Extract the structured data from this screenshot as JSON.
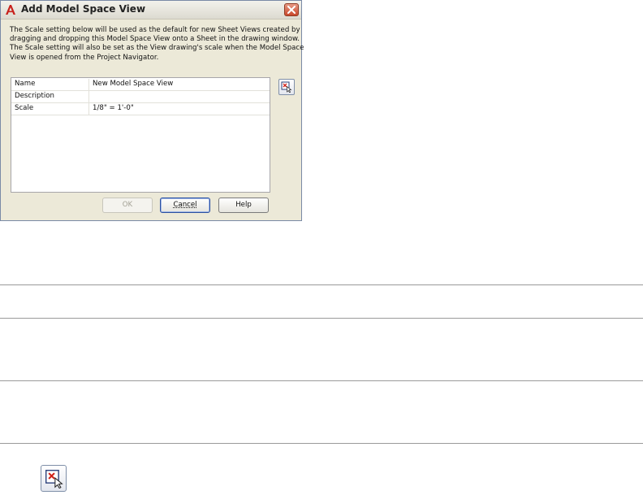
{
  "dialog": {
    "title": "Add Model Space View",
    "title_icon": "autocad-a-icon",
    "close_icon": "close-icon",
    "description_lines": [
      "The Scale setting below will be used as the default for new Sheet Views created by",
      "dragging and dropping this Model Space View onto a Sheet in the drawing window.",
      "The Scale setting will also be set as the View drawing's scale when the Model Space",
      "View is opened from the Project Navigator."
    ],
    "properties": [
      {
        "name": "Name",
        "value": "New Model Space View"
      },
      {
        "name": "Description",
        "value": ""
      },
      {
        "name": "Scale",
        "value": "1/8\" = 1'-0\""
      }
    ],
    "pick_button_icon": "define-view-window-icon",
    "buttons": {
      "ok": "OK",
      "cancel": "Cancel",
      "help": "Help"
    }
  },
  "colors": {
    "dialog_bg": "#ece9d8",
    "close_red": "#c9482c",
    "pick_icon_red": "#d0231b",
    "rule_gray": "#9a9a9a"
  },
  "standalone_icon": "define-view-window-icon"
}
